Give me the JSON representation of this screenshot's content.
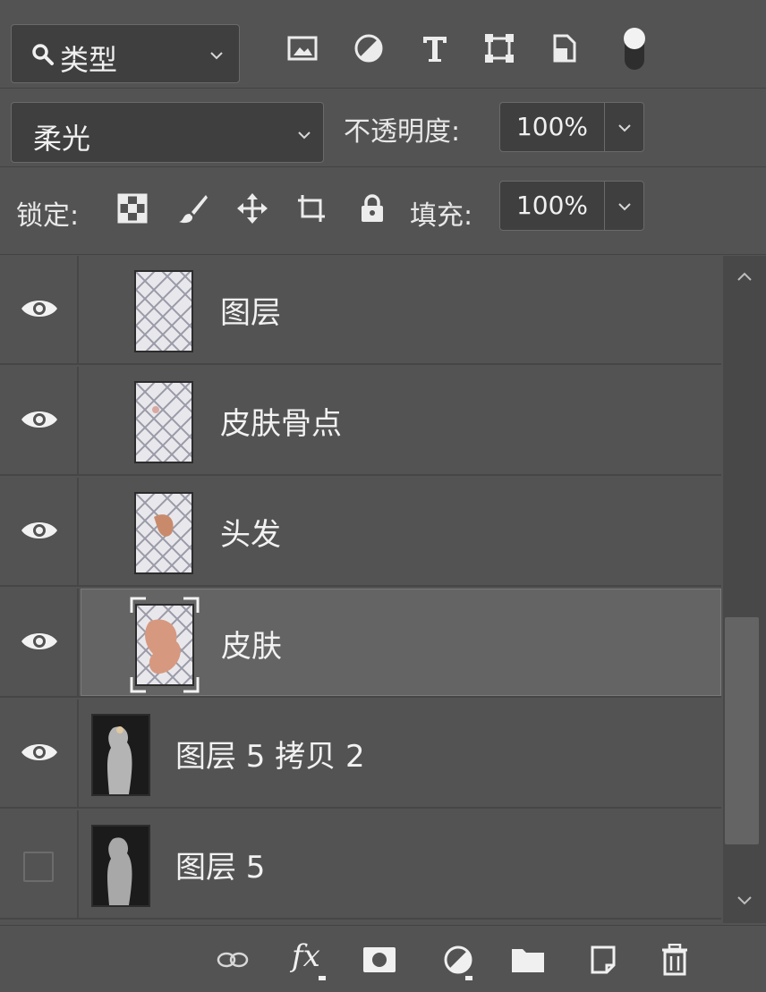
{
  "filter": {
    "type_label": "类型"
  },
  "blend": {
    "mode": "柔光",
    "opacity_label": "不透明度:",
    "opacity_value": "100%"
  },
  "lock": {
    "label": "锁定:",
    "fill_label": "填充:",
    "fill_value": "100%"
  },
  "layers": [
    {
      "name": "图层",
      "visible": true,
      "selected": false,
      "thumb": "pattern"
    },
    {
      "name": "皮肤骨点",
      "visible": true,
      "selected": false,
      "thumb": "pattern"
    },
    {
      "name": "头发",
      "visible": true,
      "selected": false,
      "thumb": "pattern"
    },
    {
      "name": "皮肤",
      "visible": true,
      "selected": true,
      "thumb": "pattern"
    },
    {
      "name": "图层 5 拷贝 2",
      "visible": true,
      "selected": false,
      "thumb": "photo"
    },
    {
      "name": "图层 5",
      "visible": false,
      "selected": false,
      "thumb": "photo"
    }
  ],
  "toolbar": {
    "fx_label": "fx"
  },
  "colors": {
    "panel_bg": "#535353",
    "field_bg": "#3f3f3f",
    "selected_layer_bg": "#646464",
    "text": "#f0f0f0"
  }
}
